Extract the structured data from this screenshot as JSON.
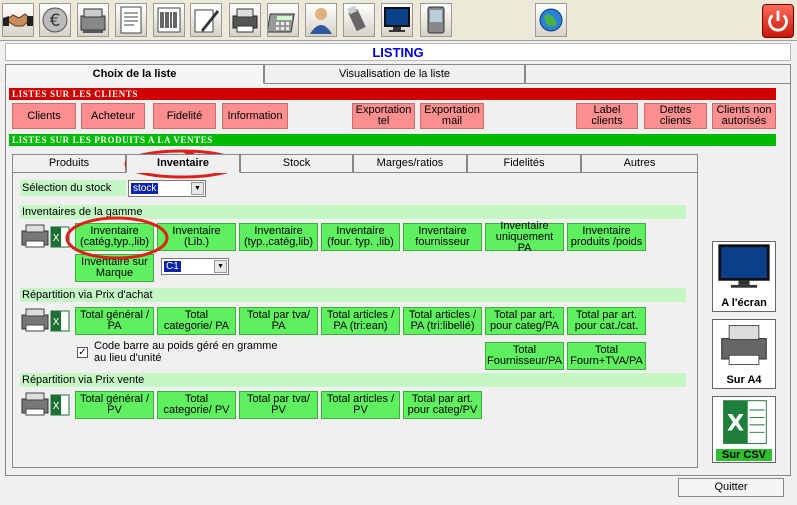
{
  "toolbar": {
    "icons": [
      "handshake-icon",
      "euro-icon",
      "cash-register-icon",
      "document-icon",
      "barcode-icon",
      "calculator-icon",
      "pen-icon",
      "printer-icon",
      "calculator-icon",
      "user-icon",
      "usb-icon",
      "monitor-icon",
      "pda-icon",
      "globe-icon",
      "power-icon"
    ]
  },
  "window": {
    "title": "LISTING"
  },
  "main_tabs": [
    "Choix de la liste",
    "Visualisation de la liste",
    ""
  ],
  "clients": {
    "header": "LISTES SUR LES CLIENTS",
    "buttons": [
      "Clients",
      "Acheteur",
      "Fidelité",
      "Information",
      "Exportation tel",
      "Exportation mail",
      "Label clients",
      "Dettes clients",
      "Clients non autorisés"
    ]
  },
  "produits": {
    "header": "LISTES SUR LES PRODUITS A LA VENTES"
  },
  "sub_tabs": [
    "Produits",
    "Inventaire",
    "Stock",
    "Marges/ratios",
    "Fidelités",
    "Autres"
  ],
  "stock_select": {
    "label": "Sélection du stock",
    "value": "stock"
  },
  "gamme": {
    "label": "Inventaires de la gamme",
    "buttons": [
      "Inventaire (catég,typ.,lib)",
      "Inventaire (Lib.)",
      "Inventaire (typ.,catég,lib)",
      "Inventaire (four. typ. ,lib)",
      "Inventaire fournisseur",
      "Inventaire uniquement PA",
      "Inventaire produits /poids"
    ],
    "marque_button": "Inventaire sur Marque",
    "marque_select": "C1"
  },
  "achat": {
    "label": "Répartition via Prix d'achat",
    "buttons": [
      "Total général / PA",
      "Total categorie/ PA",
      "Total par tva/ PA",
      "Total articles / PA (tri:ean)",
      "Total articles / PA (tri:libellé)",
      "Total par art. pour categ/PA",
      "Total par art. pour cat./cat."
    ],
    "checkbox_label": "Code barre au poids géré en gramme au lieu d'unité",
    "checkbox_checked": true,
    "buttons2": [
      "Total Fournisseur/PA",
      "Total Fourn+TVA/PA"
    ]
  },
  "vente": {
    "label": "Répartition via Prix vente",
    "buttons": [
      "Total général / PV",
      "Total categorie/ PV",
      "Total par tva/ PV",
      "Total articles / PV",
      "Total par art. pour categ/PV"
    ]
  },
  "side": {
    "ecran": "A l'écran",
    "a4": "Sur A4",
    "csv": "Sur CSV"
  },
  "quit": "Quitter",
  "colors": {
    "red_band": "#cc0000",
    "green_band": "#00bb00",
    "red_button": "#fb8f8f",
    "green_button": "#5ef05e",
    "annotation": "#e0201a",
    "title": "#0000d8"
  }
}
